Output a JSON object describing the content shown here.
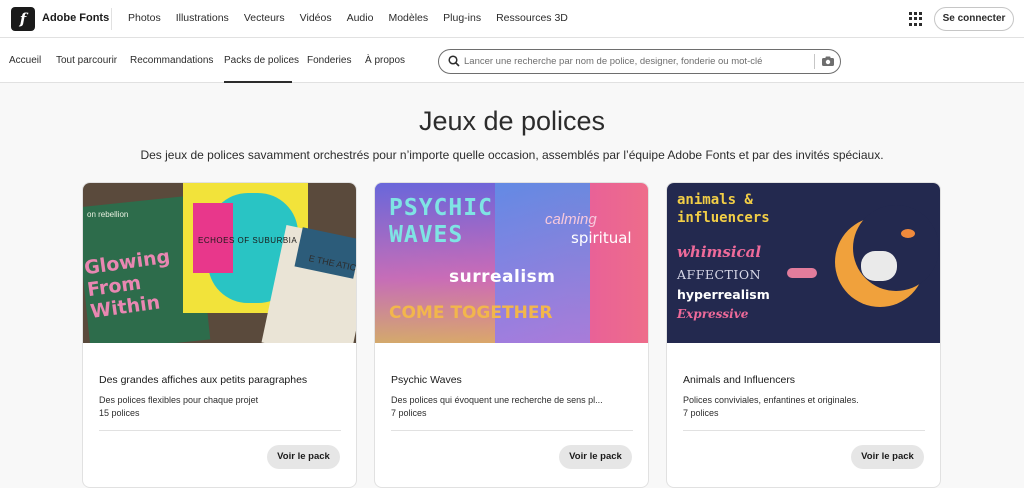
{
  "topbar": {
    "logo_letter": "f",
    "brand": "Adobe Fonts",
    "nav": [
      "Photos",
      "Illustrations",
      "Vecteurs",
      "Vidéos",
      "Audio",
      "Modèles",
      "Plug-ins",
      "Ressources 3D"
    ],
    "signin_label": "Se connecter"
  },
  "subnav": {
    "items": [
      "Accueil",
      "Tout parcourir",
      "Recommandations",
      "Packs de polices",
      "Fonderies",
      "À propos"
    ],
    "active": "Packs de polices",
    "search_placeholder": "Lancer une recherche par nom de police, designer, fonderie ou mot-clé"
  },
  "hero": {
    "title": "Jeux de polices",
    "subtitle": "Des jeux de polices savamment orchestrés pour n’importe quelle occasion, assemblés par l’équipe Adobe Fonts et par des invités spéciaux."
  },
  "cards": [
    {
      "name": "Des grandes affiches aux petits paragraphes",
      "description": "Des polices flexibles pour chaque projet",
      "count": "15 polices",
      "button": "Voir le pack",
      "art": {
        "line1": "on rebellion",
        "line2": "Glowing From Within",
        "line3": "ECHOES OF SUBURBIA",
        "line4": "E THE ATIC WAVE"
      }
    },
    {
      "name": "Psychic Waves",
      "description": "Des polices qui évoquent une recherche de sens pl...",
      "count": "7 polices",
      "button": "Voir le pack",
      "art": {
        "line1": "PSYCHIC WAVES",
        "line2": "calming",
        "line3": "spiritual",
        "line4": "surrealism",
        "line5": "COME TOGETHER"
      }
    },
    {
      "name": "Animals and Influencers",
      "description": "Polices conviviales, enfantines et originales.",
      "count": "7 polices",
      "button": "Voir le pack",
      "art": {
        "line1": "animals & influencers",
        "line2": "whimsical",
        "line3": "AFFECTION",
        "line4": "hyperrealism",
        "line5": "Expressive"
      }
    }
  ]
}
